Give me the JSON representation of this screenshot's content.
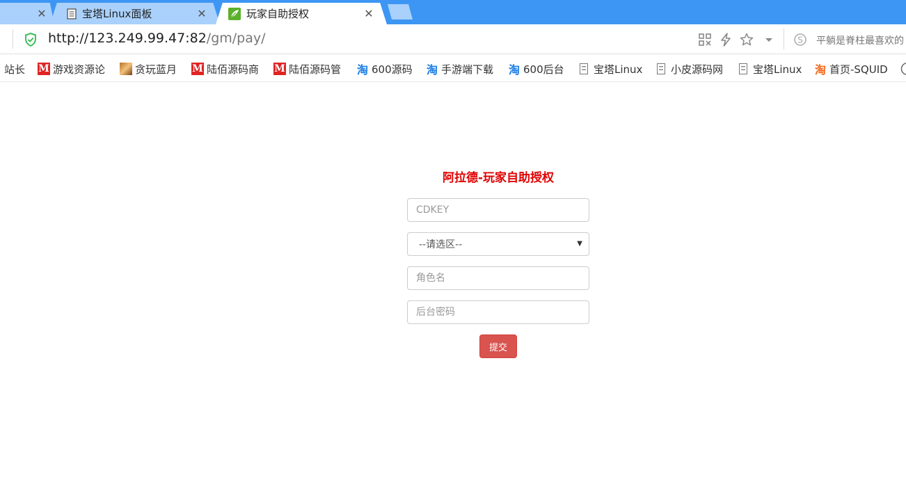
{
  "tabs": [
    {
      "title": "",
      "close": "✕"
    },
    {
      "title": "宝塔Linux面板",
      "close": "✕",
      "icon": "document-icon"
    },
    {
      "title": "玩家自助授权",
      "close": "✕",
      "icon": "leaf-icon",
      "active": true
    }
  ],
  "address": {
    "url_host": "http://123.249.99.47:82",
    "url_path": "/gm/pay/",
    "search_hint": "平躺是脊柱最喜欢的"
  },
  "bookmarks": [
    {
      "label": "站长",
      "icon": "none"
    },
    {
      "label": "游戏资源论",
      "icon": "m-icon"
    },
    {
      "label": "贪玩蓝月",
      "icon": "image-icon"
    },
    {
      "label": "陆佰源码商",
      "icon": "m-icon"
    },
    {
      "label": "陆佰源码管",
      "icon": "m-icon"
    },
    {
      "label": "600源码",
      "icon": "taobao-icon"
    },
    {
      "label": "手游端下载",
      "icon": "taobao-icon"
    },
    {
      "label": "600后台",
      "icon": "taobao-icon"
    },
    {
      "label": "宝塔Linux",
      "icon": "document-icon"
    },
    {
      "label": "小皮源码网",
      "icon": "document-icon"
    },
    {
      "label": "宝塔Linux",
      "icon": "document-icon"
    },
    {
      "label": "首页-SQUID",
      "icon": "taobao-icon"
    }
  ],
  "form": {
    "title": "阿拉德-玩家自助授权",
    "cdkey_placeholder": "CDKEY",
    "zone_select": "--请选区--",
    "role_placeholder": "角色名",
    "password_placeholder": "后台密码",
    "submit_label": "提交"
  },
  "colors": {
    "tabbar": "#3d96f3",
    "title_red": "#e00000",
    "submit_red": "#d9534f"
  }
}
